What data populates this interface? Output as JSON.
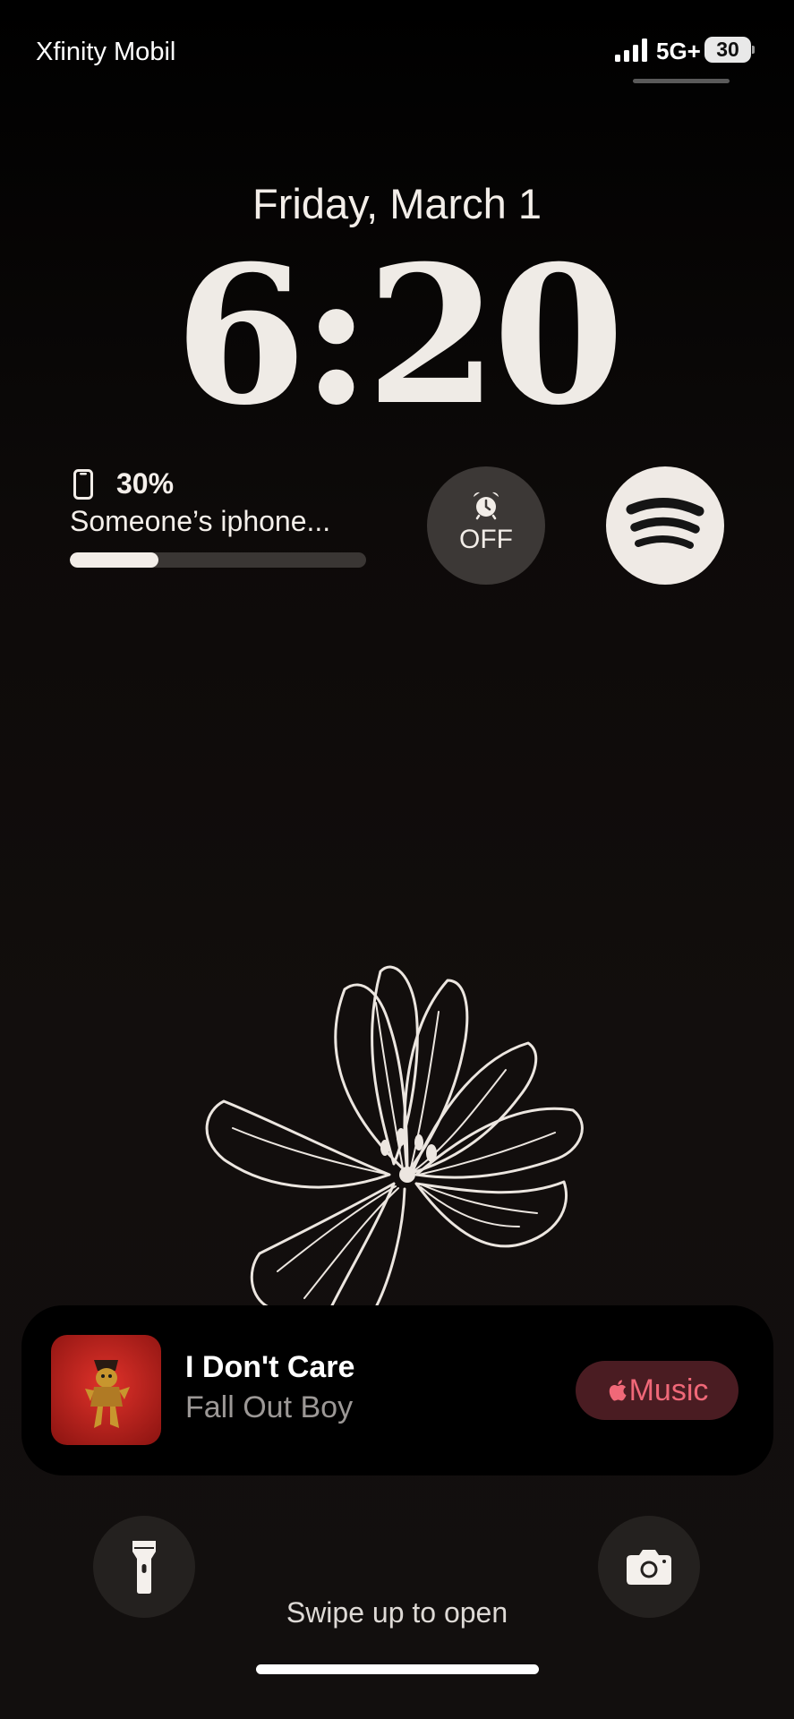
{
  "status_bar": {
    "carrier": "Xfinity Mobile",
    "network": "5G+",
    "battery_level": "30"
  },
  "lock_screen": {
    "date": "Friday, March 1",
    "time": "6:20"
  },
  "widgets": {
    "battery": {
      "percent": "30%",
      "device_name": "Someone’s iphone...",
      "level": 0.3
    },
    "alarm": {
      "label": "OFF"
    },
    "spotify": {
      "icon": "spotify-icon"
    }
  },
  "now_playing": {
    "title": "I Don't Care",
    "artist": "Fall Out Boy",
    "app_label": "Music"
  },
  "bottom": {
    "swipe_hint": "Swipe up to open"
  },
  "colors": {
    "background": "#120e0d",
    "music_accent": "#f06878",
    "music_button_bg": "#4a1c22",
    "album_red": "#c4221b"
  }
}
